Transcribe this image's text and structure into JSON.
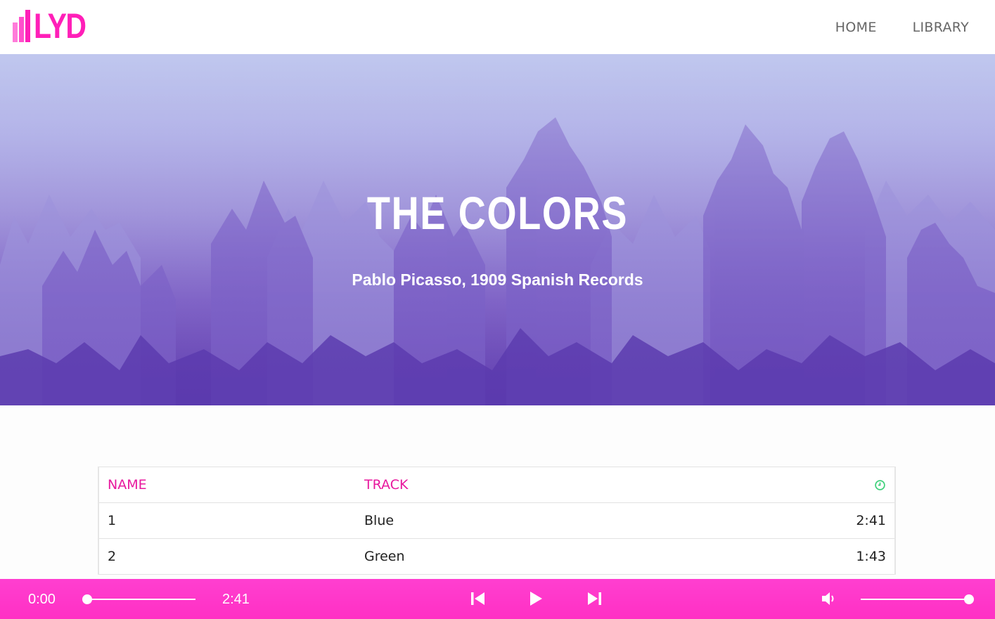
{
  "header": {
    "logo_text": "LYD",
    "nav": [
      {
        "label": "HOME"
      },
      {
        "label": "LIBRARY"
      }
    ]
  },
  "hero": {
    "title": "THE COLORS",
    "subtitle": "Pablo Picasso, 1909 Spanish Records"
  },
  "table": {
    "headers": {
      "name": "NAME",
      "track": "TRACK",
      "duration_icon": "clock-icon"
    },
    "rows": [
      {
        "name": "1",
        "track": "Blue",
        "duration": "2:41"
      },
      {
        "name": "2",
        "track": "Green",
        "duration": "1:43"
      }
    ]
  },
  "player": {
    "current_time": "0:00",
    "total_time": "2:41",
    "progress": 0,
    "volume": 1,
    "icons": [
      "skip-back-icon",
      "play-icon",
      "skip-forward-icon",
      "volume-icon"
    ]
  },
  "colors": {
    "accent": "#ff1fb8",
    "header_text": "#e8189e",
    "clock_icon": "#3dd17a",
    "player_bg": "#ff36c9"
  }
}
